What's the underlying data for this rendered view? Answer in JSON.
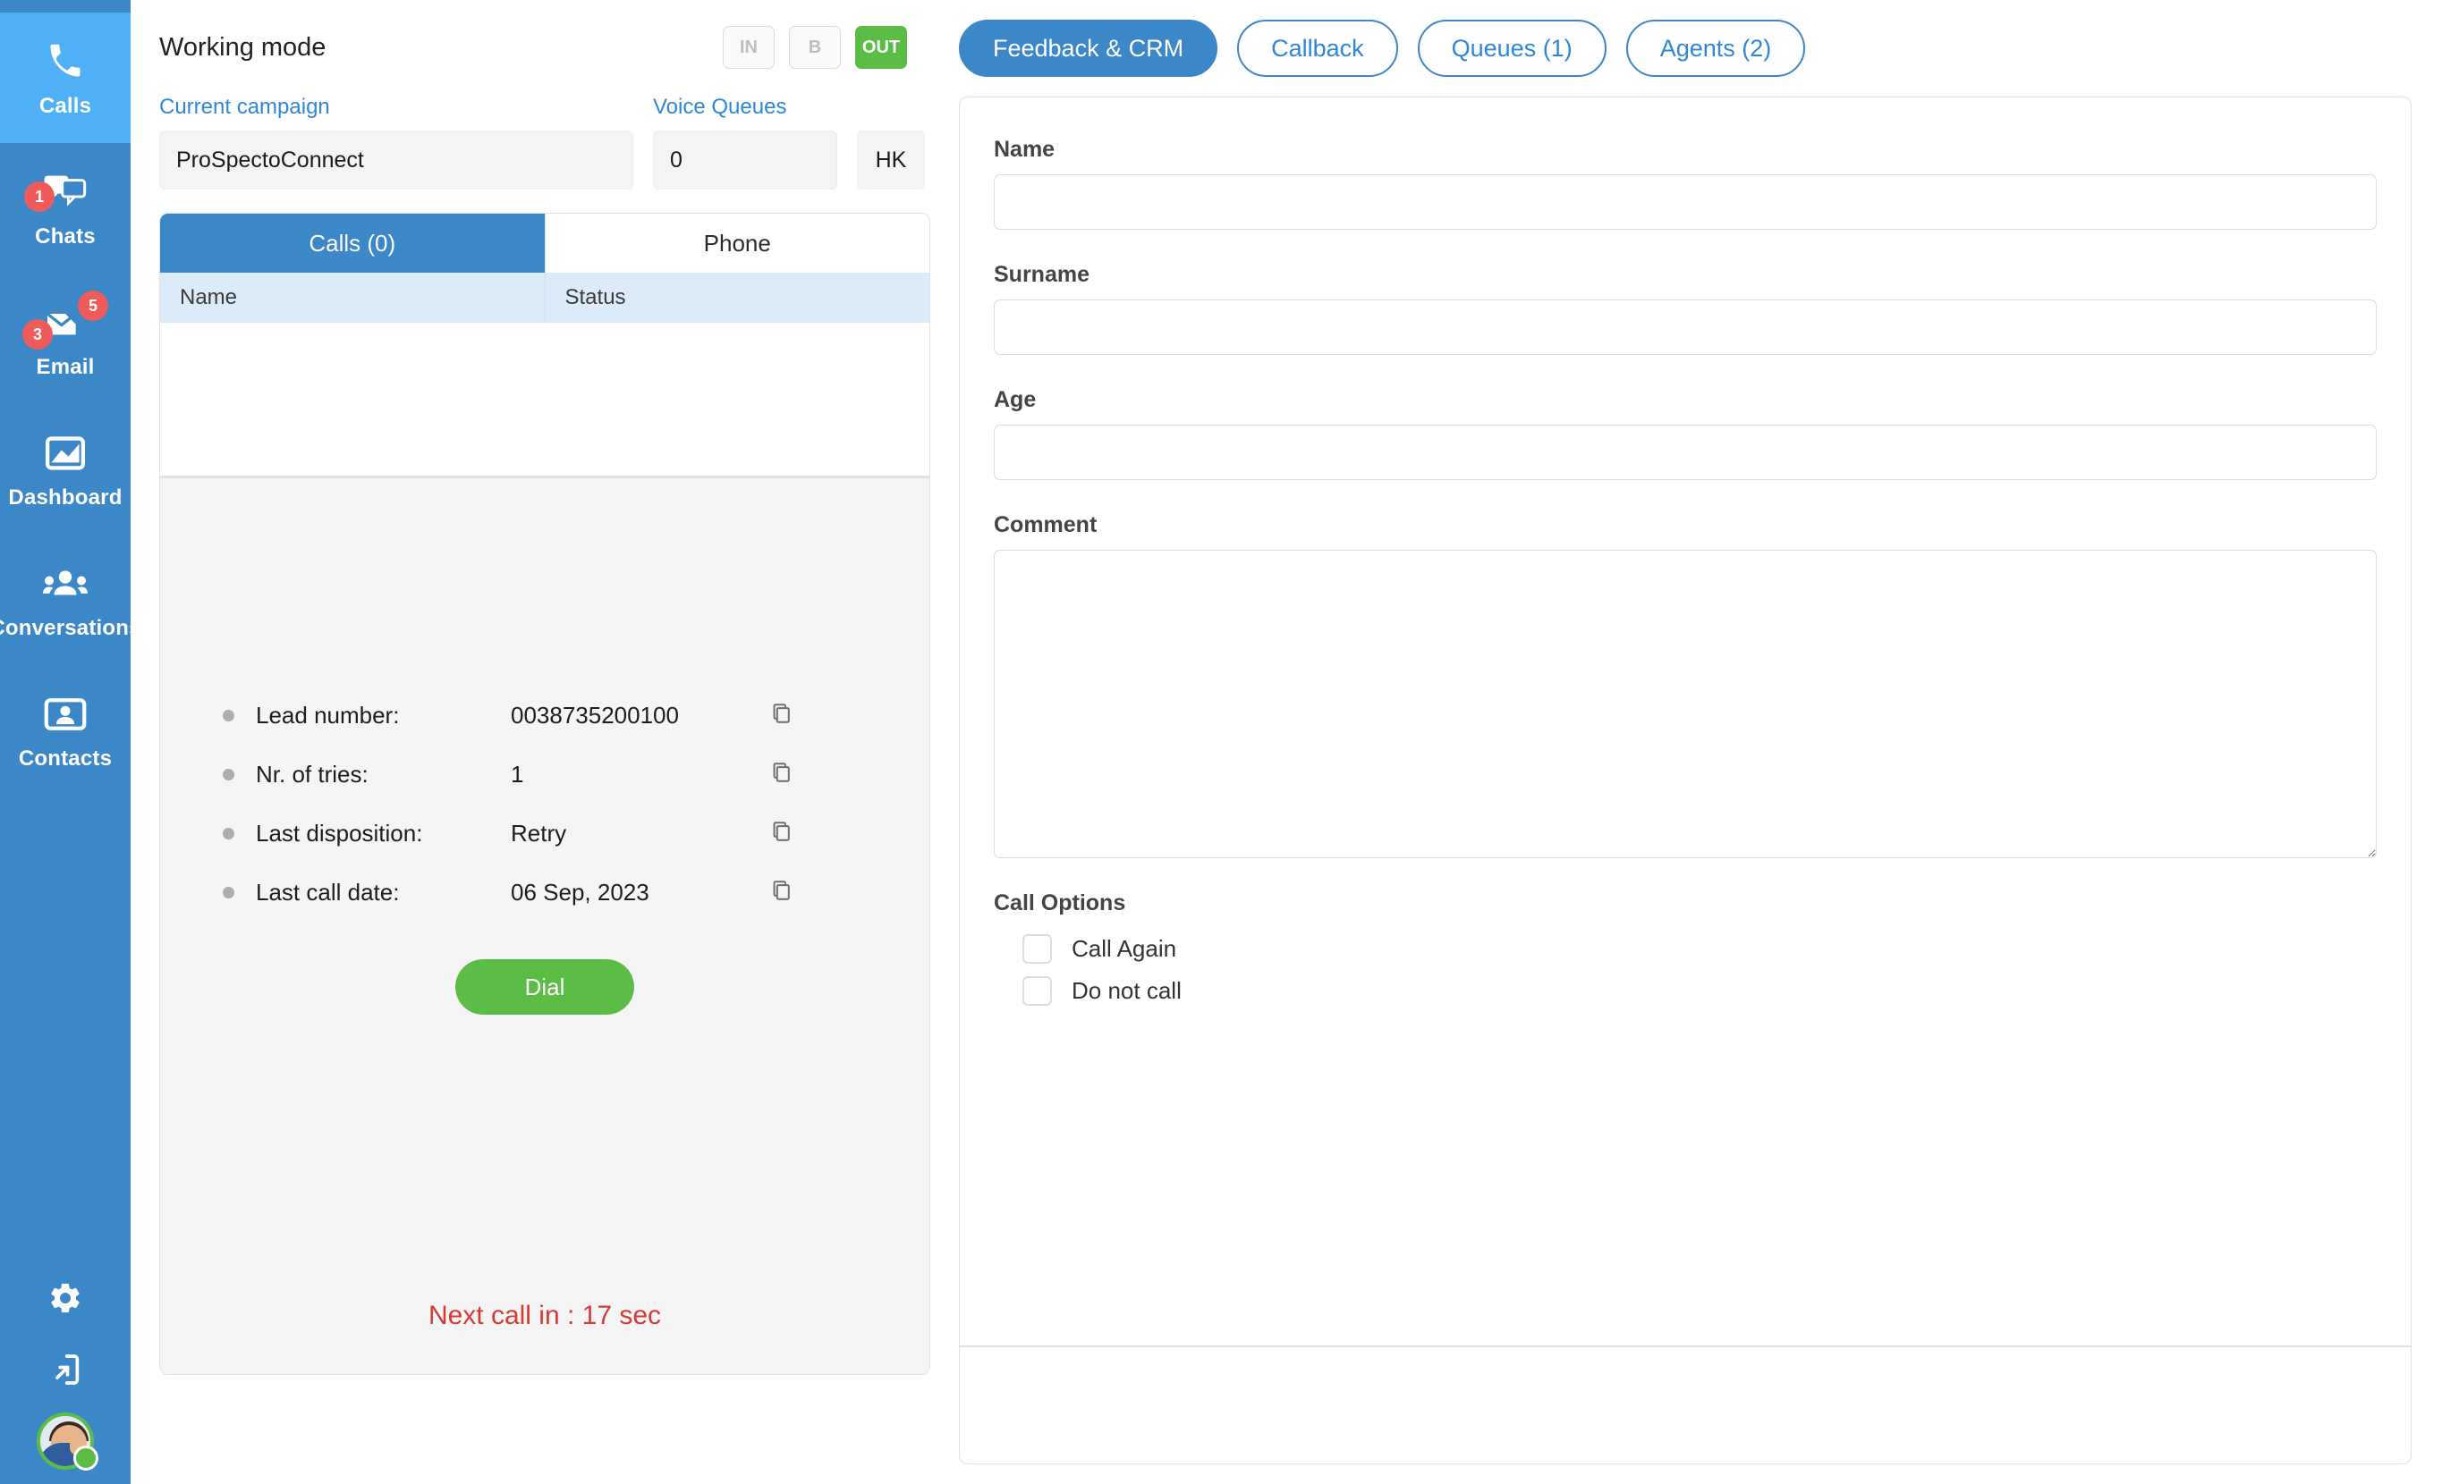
{
  "sidebar": {
    "items": [
      {
        "label": "Calls",
        "icon": "phone-icon",
        "active": true,
        "badges": []
      },
      {
        "label": "Chats",
        "icon": "chat-icon",
        "active": false,
        "badges": [
          "1"
        ]
      },
      {
        "label": "Email",
        "icon": "email-icon",
        "active": false,
        "badges": [
          "5",
          "3"
        ]
      },
      {
        "label": "Dashboard",
        "icon": "dashboard-icon",
        "active": false,
        "badges": []
      },
      {
        "label": "Conversations",
        "icon": "conversations-icon",
        "active": false,
        "badges": []
      },
      {
        "label": "Contacts",
        "icon": "contacts-icon",
        "active": false,
        "badges": []
      }
    ],
    "bottom": {
      "settings_icon": "gear-icon",
      "logout_icon": "logout-icon",
      "avatar": "user-avatar",
      "status": "online"
    },
    "badge_color": "#ef5b5b",
    "bg_color": "#3b87c8",
    "active_bg_color": "#4fb0f5"
  },
  "working_mode": {
    "title": "Working mode",
    "modes": [
      {
        "label": "IN",
        "active": false
      },
      {
        "label": "B",
        "active": false
      },
      {
        "label": "OUT",
        "active": true
      }
    ],
    "active_color": "#5cbd46"
  },
  "fields": {
    "campaign_label": "Current campaign",
    "campaign_value": "ProSpectoConnect",
    "queues_label": "Voice Queues",
    "queues_value": "0",
    "hk_value": "HK",
    "label_color": "#2e87d8"
  },
  "calls_panel": {
    "tabs": [
      {
        "label": "Calls (0)",
        "active": true
      },
      {
        "label": "Phone",
        "active": false
      }
    ],
    "columns": [
      "Name",
      "Status"
    ],
    "rows": [],
    "lead_details": [
      {
        "key": "Lead number:",
        "value": "0038735200100",
        "copy_icon": "copy-icon"
      },
      {
        "key": "Nr. of tries:",
        "value": "1",
        "copy_icon": "copy-icon"
      },
      {
        "key": "Last disposition:",
        "value": "Retry",
        "copy_icon": "copy-icon"
      },
      {
        "key": "Last call date:",
        "value": "06 Sep, 2023",
        "copy_icon": "copy-icon"
      }
    ],
    "dial_label": "Dial",
    "dial_color": "#5cbd46",
    "next_call_text": "Next call in : 17 sec",
    "next_call_color": "#d63a33"
  },
  "right_panel": {
    "tabs": [
      {
        "label": "Feedback & CRM",
        "active": true
      },
      {
        "label": "Callback",
        "active": false
      },
      {
        "label": "Queues (1)",
        "active": false
      },
      {
        "label": "Agents (2)",
        "active": false
      }
    ],
    "accent_color": "#3b87c8",
    "form": {
      "fields": [
        {
          "label": "Name",
          "value": "",
          "placeholder": "",
          "type": "text"
        },
        {
          "label": "Surname",
          "value": "",
          "placeholder": "",
          "type": "text"
        },
        {
          "label": "Age",
          "value": "",
          "placeholder": "",
          "type": "text"
        },
        {
          "label": "Comment",
          "value": "",
          "placeholder": "",
          "type": "textarea"
        }
      ],
      "options_title": "Call Options",
      "options": [
        {
          "label": "Call Again",
          "checked": false
        },
        {
          "label": "Do not call",
          "checked": false
        }
      ]
    }
  }
}
